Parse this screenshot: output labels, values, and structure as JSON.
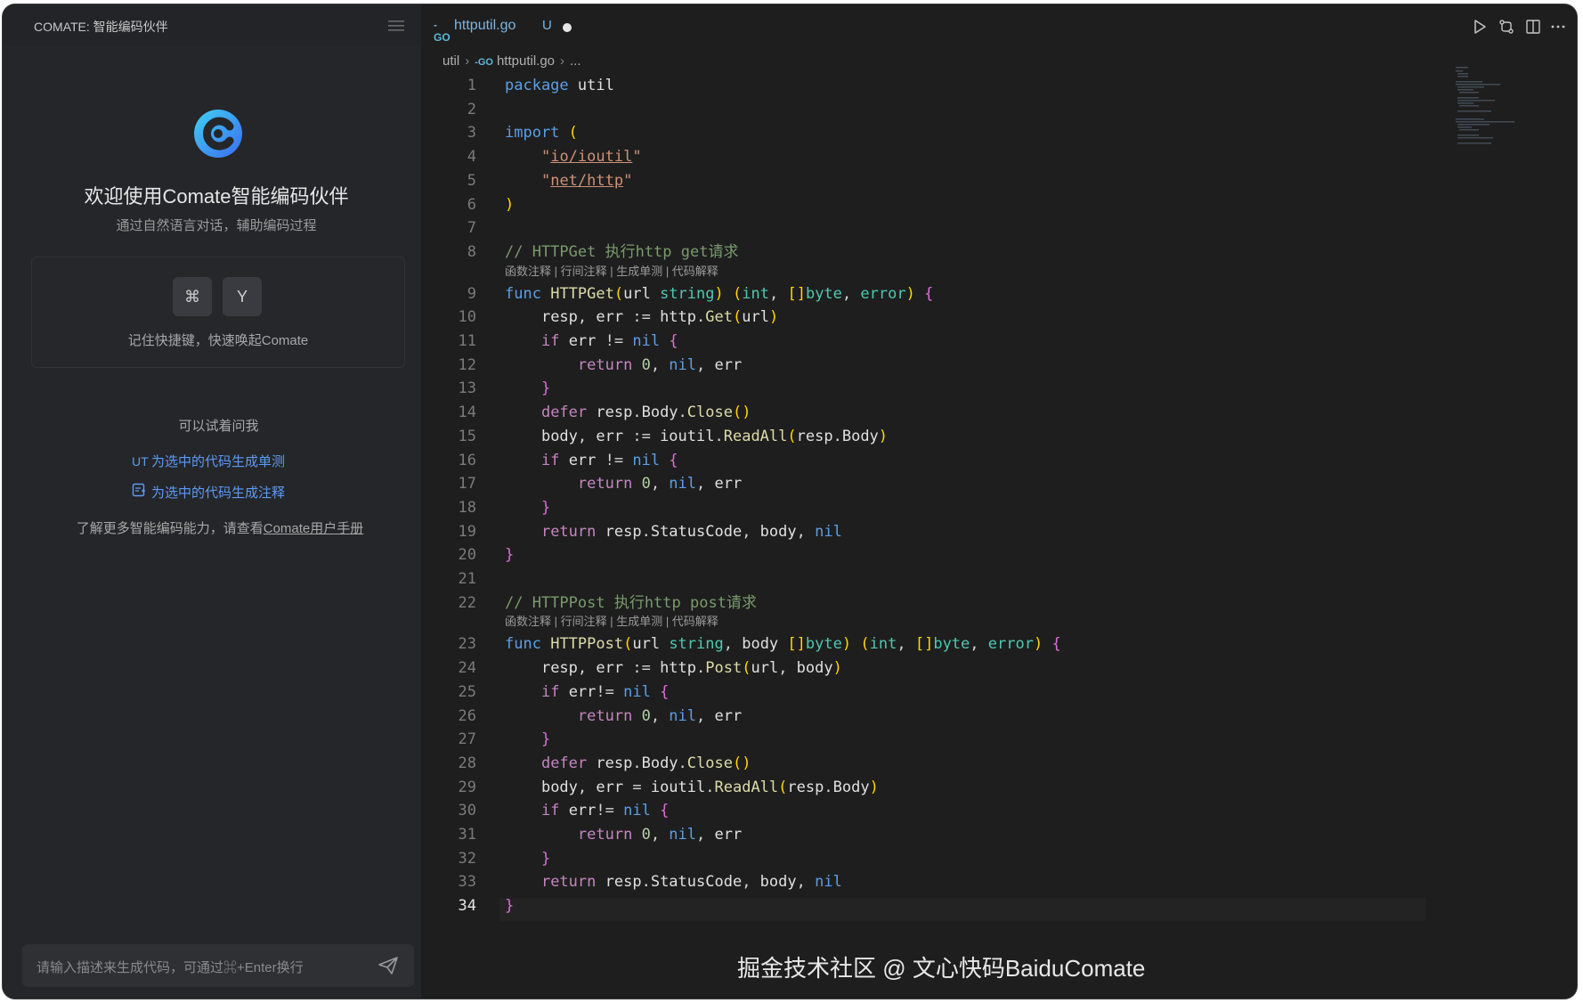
{
  "sidebar": {
    "title": "COMATE: 智能编码伙伴",
    "welcome_title": "欢迎使用Comate智能编码伙伴",
    "welcome_subtitle": "通过自然语言对话，辅助编码过程",
    "shortcut_keys": [
      "⌘",
      "Y"
    ],
    "shortcut_text": "记住快捷键，快速唤起Comate",
    "try_label": "可以试着问我",
    "suggestions": [
      {
        "icon": "UT",
        "label": "为选中的代码生成单测"
      },
      {
        "icon": "note-icon",
        "label": "为选中的代码生成注释"
      }
    ],
    "learn_more_prefix": "了解更多智能编码能力，请查看",
    "learn_more_link": "Comate用户手册",
    "input_placeholder": "请输入描述来生成代码，可通过⌘+Enter换行"
  },
  "editor": {
    "tab": {
      "icon": "-GO",
      "file": "httputil.go",
      "status": "U"
    },
    "breadcrumb": [
      "util",
      "httputil.go",
      "..."
    ],
    "code_lens": "函数注释 | 行间注释 | 生成单测 | 代码解释",
    "lines": [
      {
        "n": "1",
        "text": "package util"
      },
      {
        "n": "2",
        "text": ""
      },
      {
        "n": "3",
        "text": "import ("
      },
      {
        "n": "4",
        "text": "    \"io/ioutil\""
      },
      {
        "n": "5",
        "text": "    \"net/http\""
      },
      {
        "n": "6",
        "text": ")"
      },
      {
        "n": "7",
        "text": ""
      },
      {
        "n": "8",
        "text": "// HTTPGet 执行http get请求"
      },
      {
        "n": "9",
        "text": "func HTTPGet(url string) (int, []byte, error) {"
      },
      {
        "n": "10",
        "text": "    resp, err := http.Get(url)"
      },
      {
        "n": "11",
        "text": "    if err != nil {"
      },
      {
        "n": "12",
        "text": "        return 0, nil, err"
      },
      {
        "n": "13",
        "text": "    }"
      },
      {
        "n": "14",
        "text": "    defer resp.Body.Close()"
      },
      {
        "n": "15",
        "text": "    body, err := ioutil.ReadAll(resp.Body)"
      },
      {
        "n": "16",
        "text": "    if err != nil {"
      },
      {
        "n": "17",
        "text": "        return 0, nil, err"
      },
      {
        "n": "18",
        "text": "    }"
      },
      {
        "n": "19",
        "text": "    return resp.StatusCode, body, nil"
      },
      {
        "n": "20",
        "text": "}"
      },
      {
        "n": "21",
        "text": ""
      },
      {
        "n": "22",
        "text": "// HTTPPost 执行http post请求"
      },
      {
        "n": "23",
        "text": "func HTTPPost(url string, body []byte) (int, []byte, error) {"
      },
      {
        "n": "24",
        "text": "    resp, err := http.Post(url, body)"
      },
      {
        "n": "25",
        "text": "    if err!= nil {"
      },
      {
        "n": "26",
        "text": "        return 0, nil, err"
      },
      {
        "n": "27",
        "text": "    }"
      },
      {
        "n": "28",
        "text": "    defer resp.Body.Close()"
      },
      {
        "n": "29",
        "text": "    body, err = ioutil.ReadAll(resp.Body)"
      },
      {
        "n": "30",
        "text": "    if err!= nil {"
      },
      {
        "n": "31",
        "text": "        return 0, nil, err"
      },
      {
        "n": "32",
        "text": "    }"
      },
      {
        "n": "33",
        "text": "    return resp.StatusCode, body, nil"
      },
      {
        "n": "34",
        "text": "}"
      }
    ],
    "active_line": "34"
  },
  "watermark": "掘金技术社区 @ 文心快码BaiduComate",
  "colors": {
    "accent": "#5b9bf5",
    "keyword": "#5c9ee6",
    "function": "#dcdcaa",
    "type": "#4ec9b0",
    "string": "#ce9178",
    "comment": "#7a9a6e"
  }
}
